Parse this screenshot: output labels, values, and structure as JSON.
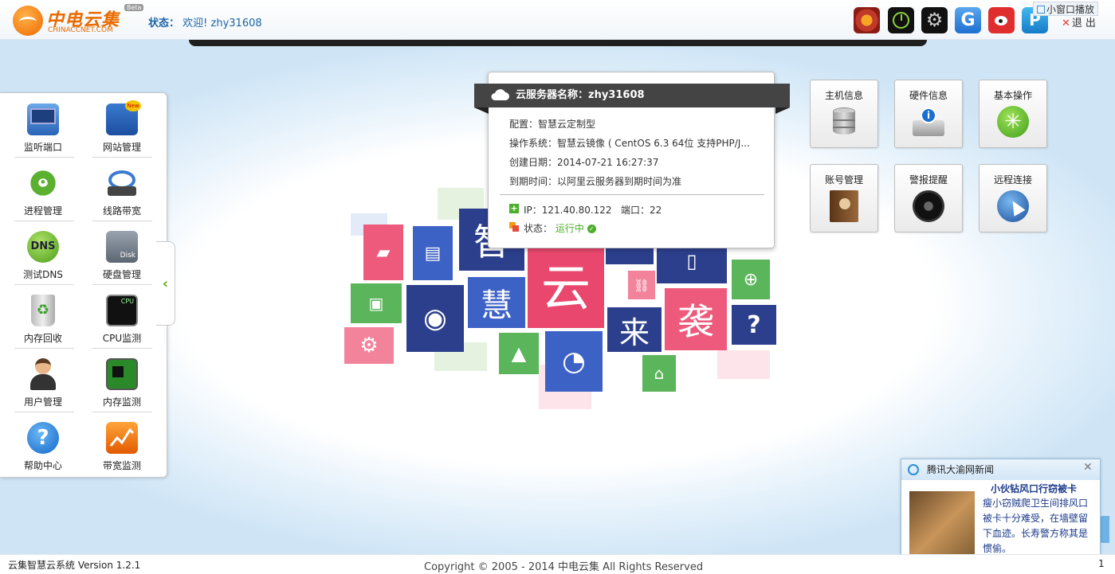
{
  "header": {
    "logo_name": "中电云集",
    "logo_en": "CHINACCNET.COM",
    "logo_badge": "Beta",
    "status_label": "状态：",
    "welcome": "欢迎!",
    "username": "zhy31608",
    "mini_window": "小窗口播放",
    "exit": "退出",
    "exit_x": "✕",
    "icons": [
      "shield-icon",
      "clock-icon",
      "gear-icon",
      "google-icon",
      "weibo-icon",
      "pp-icon"
    ]
  },
  "sidebar": {
    "items": [
      {
        "label": "监听端口",
        "icon": "port-monitor-icon"
      },
      {
        "label": "网站管理",
        "icon": "website-manage-icon",
        "badge": "New"
      },
      {
        "label": "进程管理",
        "icon": "process-gears-icon"
      },
      {
        "label": "线路带宽",
        "icon": "network-cable-icon"
      },
      {
        "label": "测试DNS",
        "icon": "dns-icon",
        "icon_text": "DNS"
      },
      {
        "label": "硬盘管理",
        "icon": "disk-icon",
        "icon_text": "Disk"
      },
      {
        "label": "内存回收",
        "icon": "recycle-bin-icon"
      },
      {
        "label": "CPU监测",
        "icon": "cpu-monitor-icon",
        "icon_text": "CPU"
      },
      {
        "label": "用户管理",
        "icon": "user-icon"
      },
      {
        "label": "内存监测",
        "icon": "memory-chip-icon"
      },
      {
        "label": "帮助中心",
        "icon": "help-icon"
      },
      {
        "label": "带宽监测",
        "icon": "bandwidth-chart-icon"
      }
    ],
    "collapse_arrow": "‹"
  },
  "tiles": {
    "zhi": "智",
    "hui": "慧",
    "yun": "云",
    "lai": "来",
    "xi": "袭"
  },
  "server": {
    "title_label": "云服务器名称：",
    "name": "zhy31608",
    "config": "配置：智慧云定制型",
    "os": "操作系统：智慧云镜像 ( CentOS 6.3 64位 支持PHP/J...",
    "created": "创建日期：2014-07-21 16:27:37",
    "expires": "到期时间：以阿里云服务器到期时间为准",
    "ip_line": "IP：121.40.80.122",
    "port_line": "端口：22",
    "status_label": "状态：",
    "status_value": "运行中",
    "plus": "+"
  },
  "actions": [
    {
      "label": "主机信息",
      "icon": "database-icon"
    },
    {
      "label": "硬件信息",
      "icon": "hardware-info-icon"
    },
    {
      "label": "基本操作",
      "icon": "basic-operation-icon"
    },
    {
      "label": "账号管理",
      "icon": "address-book-icon"
    },
    {
      "label": "警报提醒",
      "icon": "alarm-speaker-icon"
    },
    {
      "label": "远程连接",
      "icon": "remote-connect-icon"
    }
  ],
  "news": {
    "source": "腾讯大渝网新闻",
    "close": "✕",
    "headline": "小伙钻风口行窃被卡",
    "body": "瘦小窃贼爬卫生间排风口被卡十分难受，在墙壁留下血迹。长寿警方称其是惯偷。"
  },
  "footer": {
    "system": "云集智慧云系统 Version 1.2.1",
    "copyright": "Copyright © 2005 - 2014 中电云集 All Rights Reserved",
    "right_num": "1"
  },
  "colors": {
    "accent_orange": "#ef6a00",
    "tile_pink": "#ee5a7c",
    "tile_navy": "#2c3f8c",
    "tile_blue": "#3d62c6",
    "tile_green": "#5bb55b",
    "running": "#4caf2a"
  }
}
